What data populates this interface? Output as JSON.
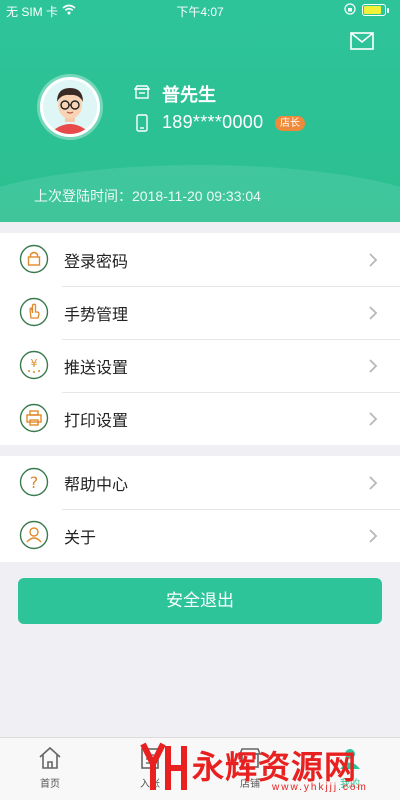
{
  "status_bar": {
    "carrier": "无 SIM 卡",
    "time": "下午4:07",
    "battery_level": 0.85
  },
  "profile": {
    "name": "普先生",
    "phone": "189****0000",
    "role_badge": "店长",
    "last_login": "上次登陆时间：2018-11-20 09:33:04"
  },
  "menu_group_1": [
    {
      "label": "登录密码",
      "icon": "lock-icon"
    },
    {
      "label": "手势管理",
      "icon": "gesture-icon"
    },
    {
      "label": "推送设置",
      "icon": "push-icon"
    },
    {
      "label": "打印设置",
      "icon": "printer-icon"
    }
  ],
  "menu_group_2": [
    {
      "label": "帮助中心",
      "icon": "help-icon"
    },
    {
      "label": "关于",
      "icon": "about-icon"
    }
  ],
  "logout_label": "安全退出",
  "tabbar": [
    {
      "label": "首页",
      "icon": "home-icon",
      "active": false
    },
    {
      "label": "入账",
      "icon": "ledger-icon",
      "active": false
    },
    {
      "label": "店铺",
      "icon": "store-icon",
      "active": false
    },
    {
      "label": "我的",
      "icon": "user-icon",
      "active": true
    }
  ],
  "watermark": {
    "text": "永辉资源网",
    "url": "www.yhkjjj.com"
  },
  "colors": {
    "accent": "#2ec49a",
    "badge": "#f08a3b",
    "watermark": "#e8201f"
  }
}
